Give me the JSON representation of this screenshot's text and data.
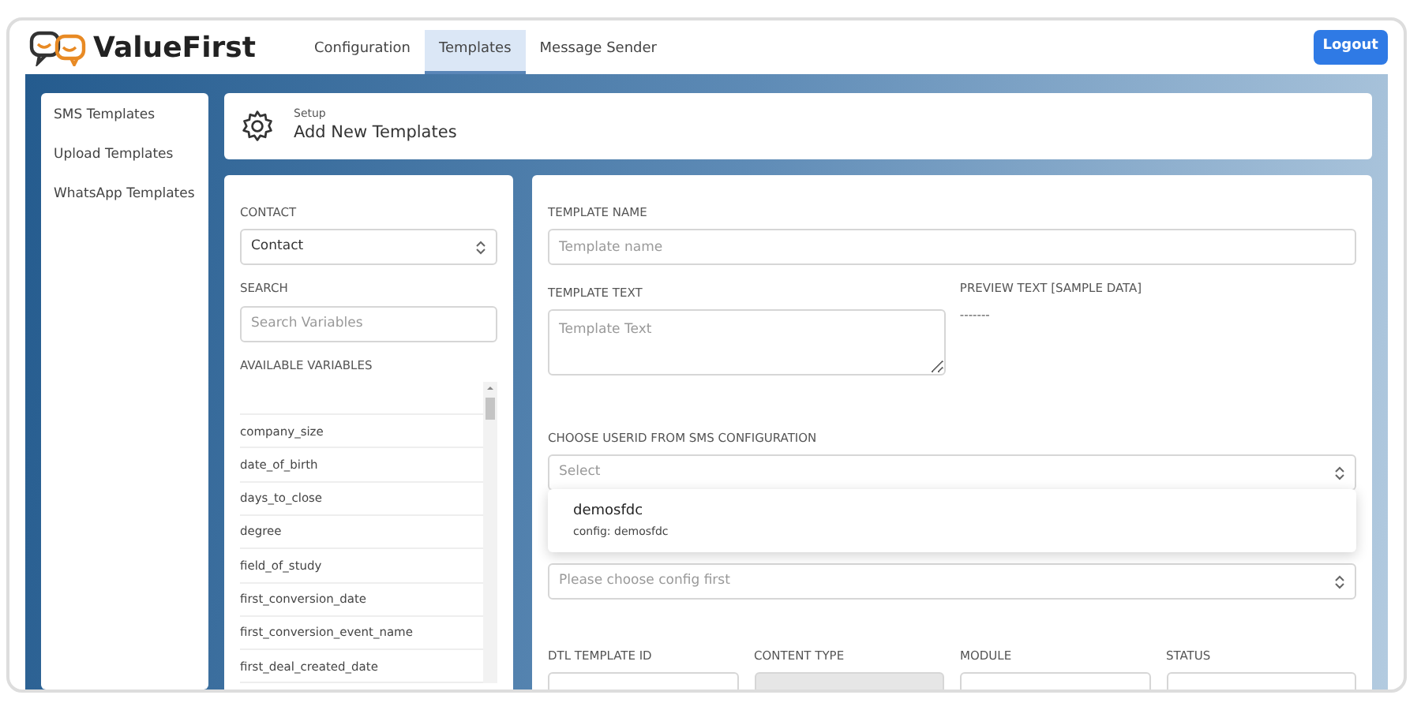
{
  "brand": "ValueFirst",
  "nav": [
    {
      "label": "Configuration",
      "selected": false
    },
    {
      "label": "Templates",
      "selected": true
    },
    {
      "label": "Message Sender",
      "selected": false
    }
  ],
  "logout": "Logout",
  "sidebar": {
    "items": [
      "SMS Templates",
      "Upload Templates",
      "WhatsApp Templates"
    ]
  },
  "header": {
    "eyebrow": "Setup",
    "title": "Add New Templates"
  },
  "variables_panel": {
    "contact": {
      "label": "CONTACT",
      "value": "Contact"
    },
    "search": {
      "label": "SEARCH",
      "placeholder": "Search Variables"
    },
    "variables_label": "AVAILABLE VARIABLES",
    "variables": [
      "company_size",
      "date_of_birth",
      "days_to_close",
      "degree",
      "field_of_study",
      "first_conversion_date",
      "first_conversion_event_name",
      "first_deal_created_date"
    ]
  },
  "form": {
    "template_name": {
      "label": "TEMPLATE NAME",
      "placeholder": "Template name"
    },
    "template_text": {
      "label": "TEMPLATE TEXT",
      "placeholder": "Template Text"
    },
    "preview": {
      "label": "PREVIEW TEXT [SAMPLE DATA]",
      "value": "-------"
    },
    "userid": {
      "label": "CHOOSE USERID FROM SMS CONFIGURATION",
      "placeholder": "Select",
      "expanded": true,
      "options": [
        {
          "title": "demosfdc",
          "subtitle": "config: demosfdc"
        }
      ]
    },
    "senderid": {
      "placeholder": "Please choose config first"
    },
    "bottom_fields": [
      {
        "label": "DTL TEMPLATE ID",
        "disabled": false
      },
      {
        "label": "CONTENT TYPE",
        "disabled": true
      },
      {
        "label": "MODULE",
        "disabled": false
      },
      {
        "label": "STATUS",
        "disabled": false
      }
    ]
  }
}
